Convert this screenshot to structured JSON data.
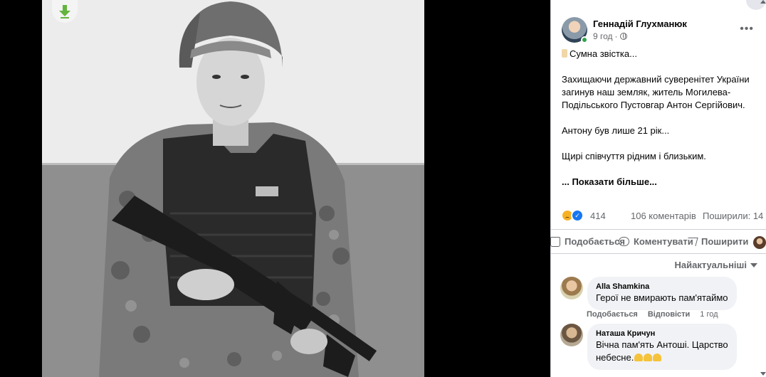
{
  "viewer": {
    "download_icon": "download-arrow-icon",
    "accent_color": "#63b43e"
  },
  "post": {
    "author": "Геннадій Глухманюк",
    "time": "9 год",
    "audience_icon": "globe-icon",
    "more_icon": "more-dots-icon",
    "headline": "Сумна звістка...",
    "paragraph1": "Захищаючи державний суверенітет України загинув наш земляк, житель Могилева-Подільського Пустовгар Антон Сергійович.",
    "paragraph2": "Антону був лише 21 рік...",
    "paragraph3": "Щирі співчуття рідним і близьким.",
    "see_more": "... Показати більше..."
  },
  "stats": {
    "reactions_count": "414",
    "comments": "106 коментарів",
    "shares": "Поширили: 14"
  },
  "actions": {
    "like": "Подобається",
    "comment": "Коментувати",
    "share": "Поширити"
  },
  "sort": {
    "label": "Найактуальніші"
  },
  "comments": [
    {
      "author": "Alla Shamkina",
      "text": "Герої не вмирають пам'ятаймо",
      "like": "Подобається",
      "reply": "Відповісти",
      "time": "1 год"
    },
    {
      "author": "Наташа Кричун",
      "text_line1": "Вічна пам'ять Антоші. Царство",
      "text_line2": "небесне."
    }
  ]
}
